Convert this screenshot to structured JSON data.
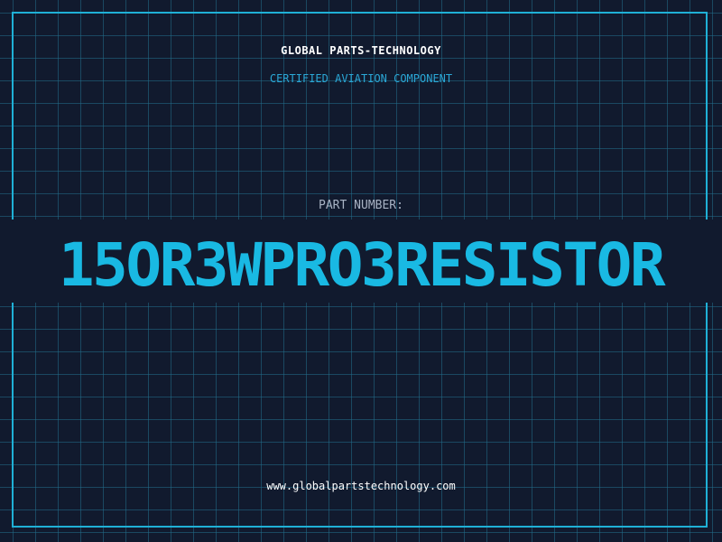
{
  "header": {
    "company": "GLOBAL PARTS-TECHNOLOGY",
    "subtitle": "CERTIFIED AVIATION COMPONENT"
  },
  "part": {
    "label": "PART NUMBER:",
    "number": "15OR3WPRO3RESISTOR"
  },
  "footer": {
    "url": "www.globalpartstechnology.com"
  },
  "colors": {
    "background": "#111a2e",
    "grid": "#226e8a",
    "frame": "#1fb0d6",
    "accent": "#19b9e3",
    "subtitle": "#2aa7d6",
    "label": "#a8b3c4",
    "text": "#ffffff"
  }
}
